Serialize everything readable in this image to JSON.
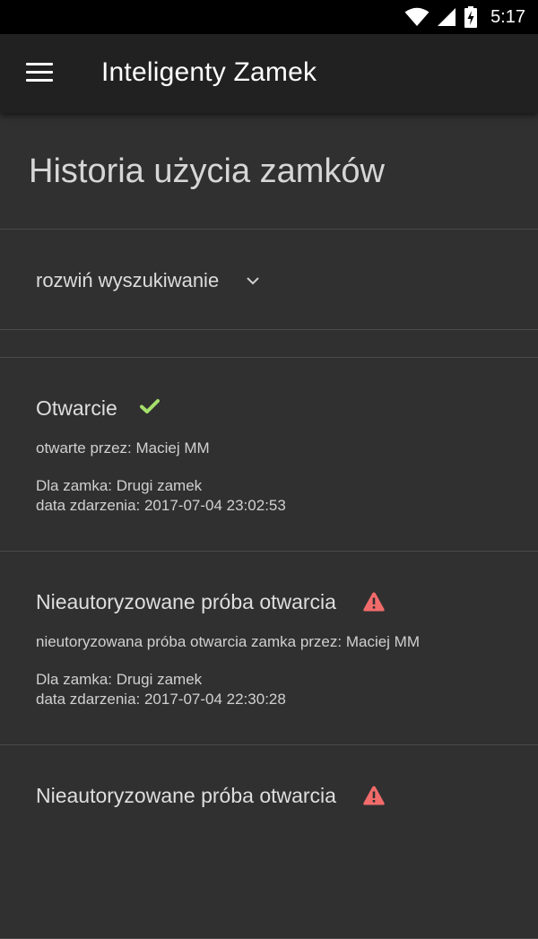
{
  "status_bar": {
    "time": "5:17",
    "icons": [
      "wifi-icon",
      "cellular-signal-icon",
      "battery-charging-icon"
    ]
  },
  "app_bar": {
    "menu_icon": "hamburger-menu-icon",
    "title": "Inteligenty Zamek"
  },
  "page": {
    "title": "Historia użycia zamków"
  },
  "search": {
    "toggle_label": "rozwiń wyszukiwanie",
    "icon": "chevron-down-icon"
  },
  "events": [
    {
      "title": "Otwarcie",
      "status_icon": "checkmark-icon",
      "status_color": "#a5e06a",
      "description": "otwarte przez: Maciej MM",
      "lock": "Dla zamka: Drugi zamek",
      "date": "data zdarzenia: 2017-07-04 23:02:53"
    },
    {
      "title": "Nieautoryzowane próba otwarcia",
      "status_icon": "warning-icon",
      "status_color": "#f26b6b",
      "description": "nieutoryzowana próba otwarcia zamka przez: Maciej MM",
      "lock": "Dla zamka: Drugi zamek",
      "date": "data zdarzenia: 2017-07-04 22:30:28"
    },
    {
      "title": "Nieautoryzowane próba otwarcia",
      "status_icon": "warning-icon",
      "status_color": "#f26b6b"
    }
  ]
}
